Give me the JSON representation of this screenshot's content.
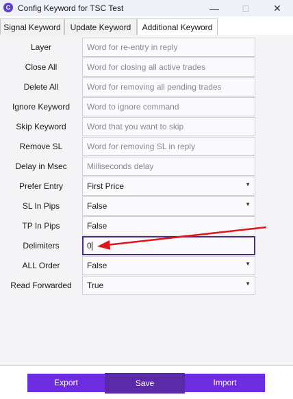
{
  "window": {
    "title": "Config Keyword for TSC Test",
    "app_icon": "C",
    "controls": {
      "minimize": "—",
      "maximize": "□",
      "close": "✕"
    }
  },
  "tabs": [
    {
      "label": "Signal Keyword",
      "active": false
    },
    {
      "label": "Update Keyword",
      "active": false
    },
    {
      "label": "Additional Keyword",
      "active": true
    }
  ],
  "fields": {
    "layer": {
      "label": "Layer",
      "placeholder": "Word for re-entry in reply"
    },
    "close_all": {
      "label": "Close All",
      "placeholder": "Word for closing all active trades"
    },
    "delete_all": {
      "label": "Delete All",
      "placeholder": "Word for removing all pending trades"
    },
    "ignore_keyword": {
      "label": "Ignore Keyword",
      "placeholder": "Word to ignore command"
    },
    "skip_keyword": {
      "label": "Skip Keyword",
      "placeholder": "Word that you want to skip"
    },
    "remove_sl": {
      "label": "Remove SL",
      "placeholder": "Word for removing SL in reply"
    },
    "delay": {
      "label": "Delay in Msec",
      "placeholder": "Milliseconds delay"
    },
    "prefer_entry": {
      "label": "Prefer Entry",
      "value": "First Price"
    },
    "sl_in_pips": {
      "label": "SL In Pips",
      "value": "False"
    },
    "tp_in_pips": {
      "label": "TP In Pips",
      "value": "False"
    },
    "delimiters": {
      "label": "Delimiters",
      "value": "0"
    },
    "all_order": {
      "label": "ALL Order",
      "value": "False"
    },
    "read_forwarded": {
      "label": "Read Forwarded",
      "value": "True"
    }
  },
  "buttons": {
    "export": "Export",
    "save": "Save",
    "import": "Import"
  },
  "colors": {
    "accent": "#6e2ce0",
    "save": "#5b2aa8",
    "focus_border": "#4b2d87",
    "annotation_arrow": "#e0161b"
  }
}
